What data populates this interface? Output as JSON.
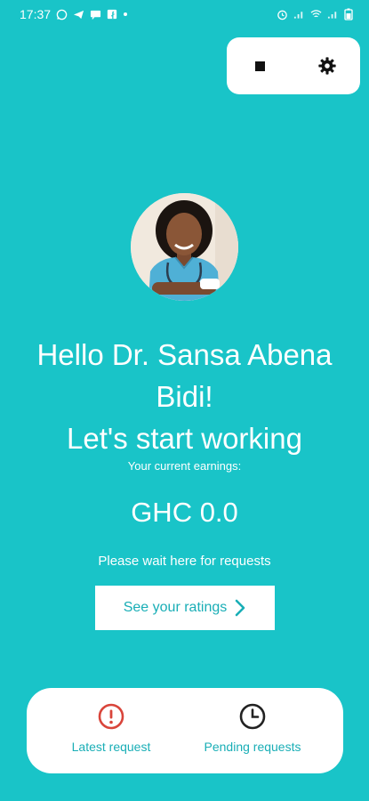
{
  "status_bar": {
    "time": "17:37",
    "notification_icons": [
      "whatsapp-icon",
      "telegram-icon",
      "message-icon",
      "facebook-icon",
      "dot-icon"
    ],
    "system_icons": [
      "alarm-icon",
      "signal-icon",
      "wifi-icon",
      "signal-icon",
      "battery-icon"
    ]
  },
  "toolbar": {
    "stop_icon": "stop-icon",
    "settings_icon": "gear-icon"
  },
  "profile": {
    "greeting_line1": "Hello Dr. Sansa Abena",
    "greeting_line2": "Bidi!",
    "greeting_line3": "Let's start working"
  },
  "earnings": {
    "label": "Your current earnings:",
    "value": "GHC 0.0"
  },
  "wait_text": "Please wait here for requests",
  "ratings_button": {
    "label": "See your ratings",
    "icon": "chevron-right-icon"
  },
  "bottom_nav": {
    "latest": {
      "label": "Latest request",
      "icon": "alert-circle-icon",
      "color": "#d9453b"
    },
    "pending": {
      "label": "Pending requests",
      "icon": "clock-icon",
      "color": "#222222"
    }
  },
  "colors": {
    "background": "#19c4c8",
    "accent": "#19aeb6"
  }
}
